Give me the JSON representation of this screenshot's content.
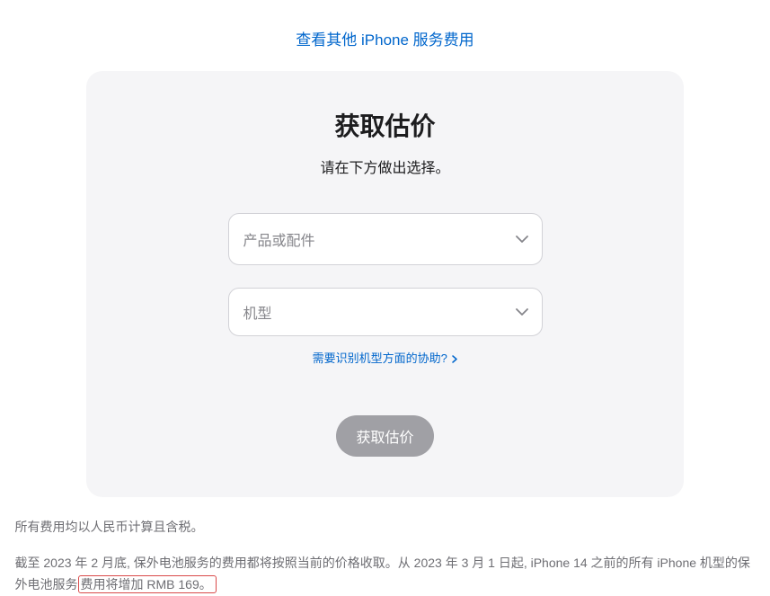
{
  "top_link": "查看其他 iPhone 服务费用",
  "card": {
    "title": "获取估价",
    "subtitle": "请在下方做出选择。",
    "select_product_placeholder": "产品或配件",
    "select_model_placeholder": "机型",
    "help_text": "需要识别机型方面的协助?",
    "submit_label": "获取估价"
  },
  "footnote1": "所有费用均以人民币计算且含税。",
  "footnote2_pre": "截至 2023 年 2 月底, 保外电池服务的费用都将按照当前的价格收取。从 2023 年 3 月 1 日起, iPhone 14 之前的所有 iPhone 机型的保外电池服务",
  "footnote2_highlight": "费用将增加 RMB 169。"
}
